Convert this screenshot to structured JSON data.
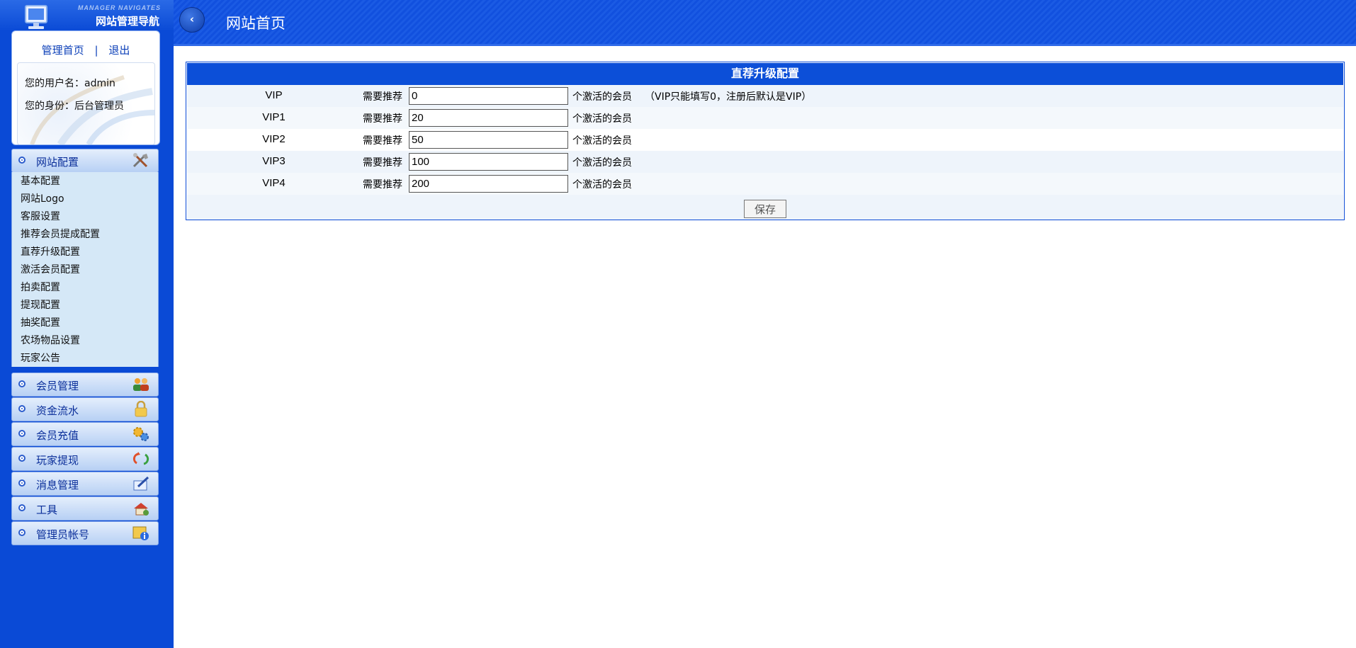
{
  "sidebar": {
    "header_sub": "MANAGER NAVIGATES",
    "header_title": "网站管理导航",
    "links": {
      "home": "管理首页",
      "separator": "|",
      "logout": "退出"
    },
    "user_line": "您的用户名：admin",
    "role_line": "您的身份：后台管理员",
    "menus": [
      {
        "label": "网站配置",
        "icon": "tools-icon"
      },
      {
        "label": "会员管理",
        "icon": "users-icon"
      },
      {
        "label": "资金流水",
        "icon": "lock-icon"
      },
      {
        "label": "会员充值",
        "icon": "gears-icon"
      },
      {
        "label": "玩家提现",
        "icon": "refresh-icon"
      },
      {
        "label": "消息管理",
        "icon": "edit-icon"
      },
      {
        "label": "工具",
        "icon": "toolbox-icon"
      },
      {
        "label": "管理员帐号",
        "icon": "info-icon"
      }
    ],
    "submenu": [
      "基本配置",
      "网站Logo",
      "客服设置",
      "推荐会员提成配置",
      "直荐升级配置",
      "激活会员配置",
      "拍卖配置",
      "提现配置",
      "抽奖配置",
      "农场物品设置",
      "玩家公告"
    ]
  },
  "header": {
    "back_label": "‹",
    "title": "网站首页"
  },
  "form": {
    "title": "直荐升级配置",
    "prefix": "需要推荐",
    "suffix": "个激活的会员",
    "rows": [
      {
        "level": "VIP",
        "value": "0",
        "note": "（VIP只能填写0，注册后默认是VIP）"
      },
      {
        "level": "VIP1",
        "value": "20",
        "note": ""
      },
      {
        "level": "VIP2",
        "value": "50",
        "note": ""
      },
      {
        "level": "VIP3",
        "value": "100",
        "note": ""
      },
      {
        "level": "VIP4",
        "value": "200",
        "note": ""
      }
    ],
    "save_label": "保存"
  },
  "colors": {
    "brand_blue": "#0a4ad6",
    "row_alt": "#eef4fb",
    "submenu_bg": "#d5e8f7"
  }
}
